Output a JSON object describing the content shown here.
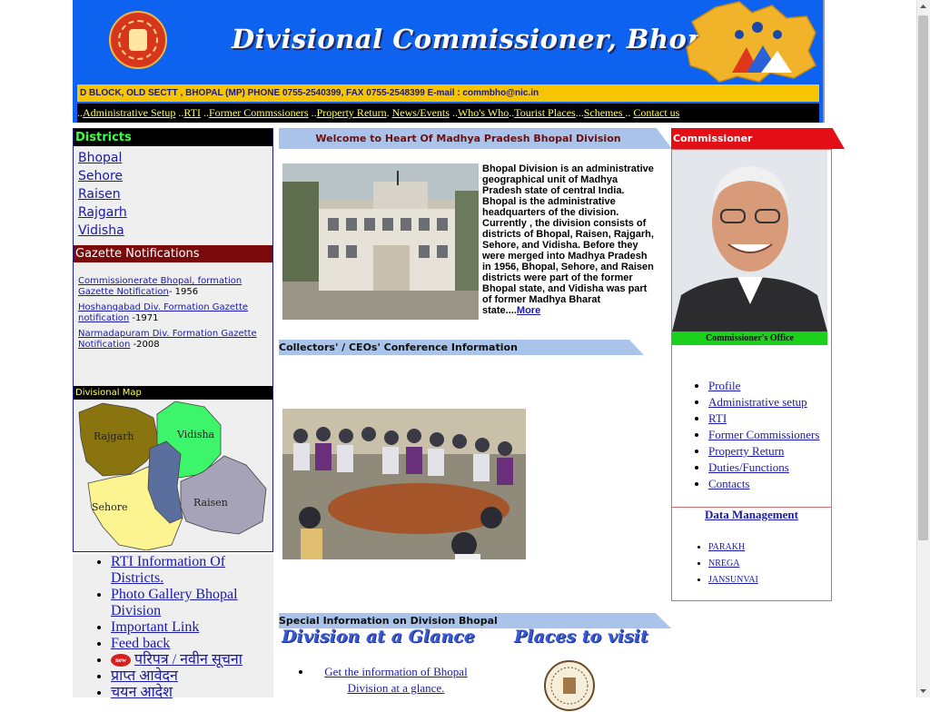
{
  "header": {
    "title": "Divisional Commissioner, Bhopal",
    "contact": "D BLOCK, OLD SECTT , BHOPAL  (MP)  PHONE 0755-2540399, FAX 0755-2548399 E-mail : commbho@nic.in",
    "brand_color": "#0d62f0"
  },
  "topnav": [
    {
      "sep": "..",
      "label": "Administrative Setup"
    },
    {
      "sep": " ..",
      "label": "RTI"
    },
    {
      "sep": " ..",
      "label": "Former Commssioners"
    },
    {
      "sep": " ..",
      "label": "Property Return"
    },
    {
      "sep": ". ",
      "label": "News/Events"
    },
    {
      "sep": " ..",
      "label": "Who's Who"
    },
    {
      "sep": "..",
      "label": "Tourist Places"
    },
    {
      "sep": "...",
      "label": "Schemes "
    },
    {
      "sep": ".. ",
      "label": "Contact us"
    }
  ],
  "districts": {
    "heading": "Districts",
    "items": [
      "Bhopal",
      "Sehore",
      "Raisen",
      "Rajgarh",
      "Vidisha"
    ]
  },
  "gazette": {
    "heading": "Gazette Notifications",
    "items": [
      {
        "link": "Commissionerate Bhopal, formation Gazette  Notification",
        "suffix": "- 1956"
      },
      {
        "link": "Hoshangabad Div. Formation Gazette notification",
        "suffix": " -1971"
      },
      {
        "link": "Narmadapuram Div. Formation Gazette Notification",
        "suffix": " -2008"
      }
    ]
  },
  "divisional_map": {
    "heading": "Divisional Map",
    "labels": [
      "Rajgarh",
      "Vidisha",
      "Sehore",
      "Raisen"
    ]
  },
  "left_links": {
    "rti": "RTI Information Of Districts.",
    "gallery": "Photo Gallery Bhopal Division",
    "important": "Important Link",
    "feedback": "Feed back",
    "new_badge": "new",
    "paripatra": "परिपत्र / नवीन सूचना",
    "prapt": "प्राप्त आवेदन",
    "chayan": "चयन आदेश"
  },
  "welcome": {
    "heading": "Welcome to Heart Of Madhya Pradesh Bhopal Division",
    "intro": "Bhopal Division is an administrative geographical unit of Madhya Pradesh state of central India. Bhopal is the administrative headquarters of the division. Currently , the division consists of districts of Bhopal, Raisen, Rajgarh, Sehore, and Vidisha. Before they were merged into Madhya Pradesh in 1956, Bhopal, Sehore, and Raisen districts were part of the former Bhopal state, and Vidisha was part of former Madhya Bharat state....",
    "more": "More"
  },
  "collectors": {
    "heading": "Collectors' / CEOs' Conference Information"
  },
  "special": {
    "heading": "Special Information on Division Bhopal",
    "glance_title": "Division at a Glance",
    "places_title": "Places to visit",
    "glance_link": "Get the information of Bhopal Division at a glance."
  },
  "commissioner": {
    "tab": "Commissioner",
    "office": "Commissioner's Office",
    "links": [
      "Profile",
      "Administrative setup",
      "RTI",
      "Former Commissioners",
      "Property Return",
      "Duties/Functions",
      "Contacts"
    ]
  },
  "data_management": {
    "heading": "Data Management",
    "links": [
      "PARAKH",
      "NREGA",
      "JANSUNVAI"
    ]
  }
}
